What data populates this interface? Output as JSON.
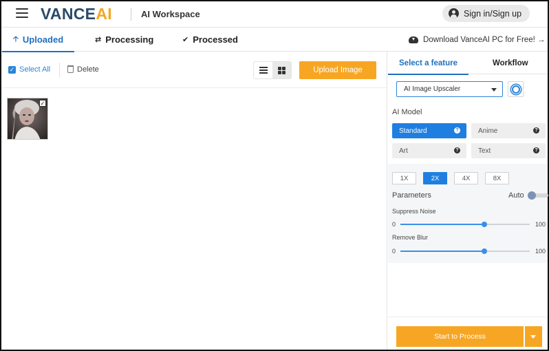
{
  "header": {
    "logo_main": "VANCE",
    "logo_accent": "AI",
    "workspace": "AI Workspace",
    "signin": "Sign in/Sign up"
  },
  "tabs": [
    {
      "label": "Uploaded",
      "icon": "upload-arrow-icon",
      "active": true
    },
    {
      "label": "Processing",
      "icon": "refresh-icon",
      "active": false
    },
    {
      "label": "Processed",
      "icon": "check-circle-icon",
      "active": false
    }
  ],
  "download_link": "Download VanceAI PC for Free! →",
  "toolbar": {
    "select_all": "Select All",
    "delete": "Delete",
    "upload": "Upload Image",
    "view_mode": "grid"
  },
  "uploaded_images": [
    {
      "thumbnail": "black-and-white-portrait",
      "checked": true
    }
  ],
  "panel": {
    "tabs": [
      "Select a feature",
      "Workflow"
    ],
    "active_tab": "Select a feature",
    "feature_selected": "AI Image Upscaler",
    "ai_model_label": "AI Model",
    "models": [
      {
        "label": "Standard",
        "selected": true
      },
      {
        "label": "Anime",
        "selected": false
      },
      {
        "label": "Art",
        "selected": false
      },
      {
        "label": "Text",
        "selected": false
      }
    ],
    "scales": [
      {
        "label": "1X",
        "selected": false
      },
      {
        "label": "2X",
        "selected": true
      },
      {
        "label": "4X",
        "selected": false
      },
      {
        "label": "8X",
        "selected": false
      }
    ],
    "parameters_label": "Parameters",
    "auto_label": "Auto",
    "auto_enabled": false,
    "suppress_noise": {
      "label": "Suppress Noise",
      "min": "0",
      "max": "100",
      "value_fraction": 0.65
    },
    "remove_blur": {
      "label": "Remove Blur",
      "min": "0",
      "max": "100",
      "value_fraction": 0.65
    },
    "start_button": "Start to Process"
  },
  "colors": {
    "brand_blue": "#2a4a6b",
    "accent_orange": "#f7a623",
    "active_blue": "#1f6fbf",
    "selected_blue": "#1f7fe0"
  }
}
